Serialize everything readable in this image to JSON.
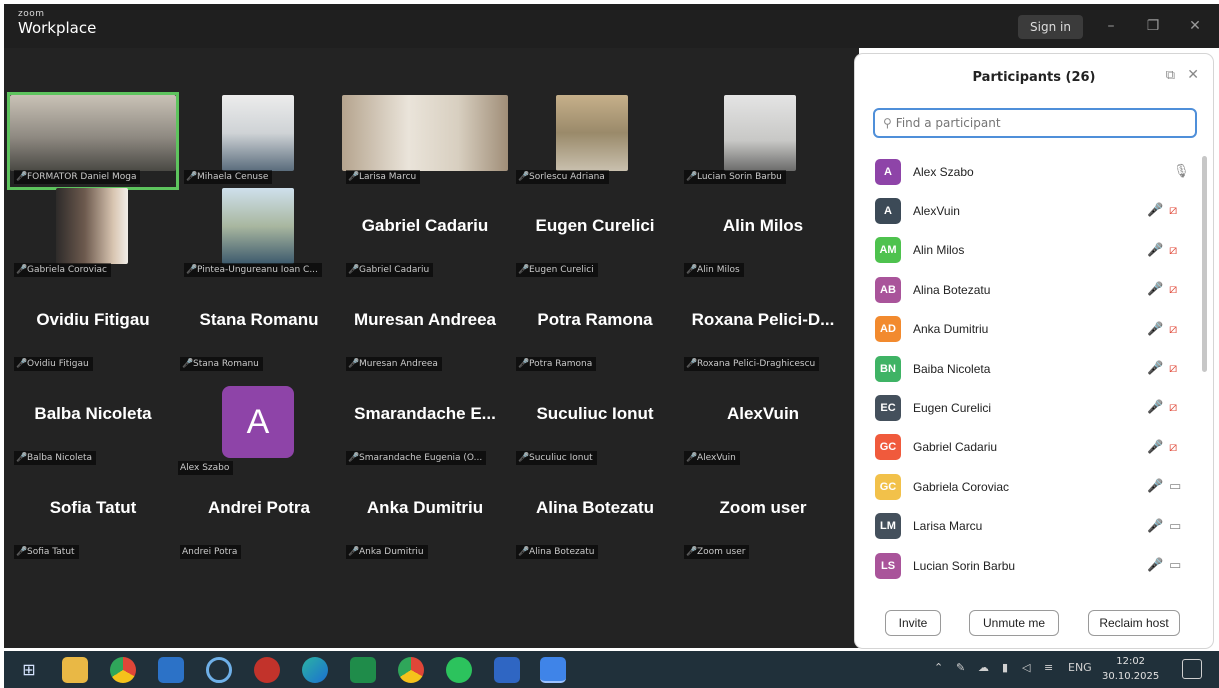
{
  "titlebar": {
    "brand_small": "zoom",
    "brand_big": "Workplace",
    "signin_label": "Sign in",
    "minimize_glyph": "–",
    "restore_glyph": "❐",
    "close_glyph": "✕"
  },
  "gallery": {
    "video_tiles": [
      {
        "label": "FORMATOR Daniel Moga",
        "speaker": true
      },
      {
        "label": "Mihaela Cenuse"
      },
      {
        "label": "Larisa Marcu"
      },
      {
        "label": "Sorlescu Adriana"
      },
      {
        "label": "Lucian Sorin Barbu"
      },
      {
        "label": "Gabriela Coroviac"
      },
      {
        "label": "Pintea-Ungureanu Ioan C..."
      }
    ],
    "name_tiles": [
      {
        "name": "Gabriel Cadariu",
        "label": "Gabriel Cadariu"
      },
      {
        "name": "Eugen Curelici",
        "label": "Eugen Curelici"
      },
      {
        "name": "Alin Milos",
        "label": "Alin Milos"
      },
      {
        "name": "Ovidiu Fitigau",
        "label": "Ovidiu Fitigau"
      },
      {
        "name": "Stana Romanu",
        "label": "Stana Romanu"
      },
      {
        "name": "Muresan Andreea",
        "label": "Muresan Andreea"
      },
      {
        "name": "Potra Ramona",
        "label": "Potra Ramona"
      },
      {
        "name": "Roxana Pelici-D...",
        "label": "Roxana Pelici-Draghicescu"
      },
      {
        "name": "Balba Nicoleta",
        "label": "Balba Nicoleta"
      },
      {
        "name": "Smarandache E...",
        "label": "Smarandache Eugenia (O..."
      },
      {
        "name": "Suculiuc Ionut",
        "label": "Suculiuc Ionut"
      },
      {
        "name": "AlexVuin",
        "label": "AlexVuin"
      },
      {
        "name": "Sofia Tatut",
        "label": "Sofia Tatut"
      },
      {
        "name": "Andrei Potra",
        "label": "Andrei Potra"
      },
      {
        "name": "Anka Dumitriu",
        "label": "Anka Dumitriu"
      },
      {
        "name": "Alina Botezatu",
        "label": "Alina Botezatu"
      },
      {
        "name": "Zoom user",
        "label": "Zoom user"
      }
    ],
    "avatar_tile": {
      "initial": "A",
      "label": "Alex Szabo",
      "color": "#8e44a8"
    }
  },
  "participants": {
    "title": "Participants (26)",
    "search_placeholder": "Find a participant",
    "list": [
      {
        "initials": "A",
        "name": "Alex Szabo",
        "color": "#8e44a8",
        "mic": "plain",
        "cam": "none"
      },
      {
        "initials": "A",
        "name": "AlexVuin",
        "color": "#3c4a57",
        "mic": "off",
        "cam": "off"
      },
      {
        "initials": "AM",
        "name": "Alin Milos",
        "color": "#4ec24e",
        "mic": "off",
        "cam": "off"
      },
      {
        "initials": "AB",
        "name": "Alina Botezatu",
        "color": "#a9549a",
        "mic": "off",
        "cam": "off"
      },
      {
        "initials": "AD",
        "name": "Anka Dumitriu",
        "color": "#f28a2e",
        "mic": "off",
        "cam": "off"
      },
      {
        "initials": "BN",
        "name": "Baiba Nicoleta",
        "color": "#3fb365",
        "mic": "off",
        "cam": "off"
      },
      {
        "initials": "EC",
        "name": "Eugen Curelici",
        "color": "#44505c",
        "mic": "off",
        "cam": "off"
      },
      {
        "initials": "GC",
        "name": "Gabriel Cadariu",
        "color": "#f05a3c",
        "mic": "off",
        "cam": "off"
      },
      {
        "initials": "GC",
        "name": "Gabriela Coroviac",
        "color": "#f2c14a",
        "mic": "off",
        "cam": "on"
      },
      {
        "initials": "LM",
        "name": "Larisa Marcu",
        "color": "#44505c",
        "mic": "off",
        "cam": "on"
      },
      {
        "initials": "LS",
        "name": "Lucian Sorin Barbu",
        "color": "#a9549a",
        "mic": "off",
        "cam": "on"
      }
    ],
    "invite_label": "Invite",
    "unmute_label": "Unmute me",
    "reclaim_label": "Reclaim host"
  },
  "taskbar": {
    "lang": "ENG",
    "time": "12:02",
    "date": "30.10.2025",
    "apps": [
      "windows-icon",
      "file-explorer-icon",
      "chrome-icon",
      "outlook-icon",
      "cortana-icon",
      "antivirus-icon",
      "edge-icon",
      "excel-icon",
      "chrome-icon",
      "whatsapp-icon",
      "word-icon",
      "zoom-icon"
    ]
  }
}
